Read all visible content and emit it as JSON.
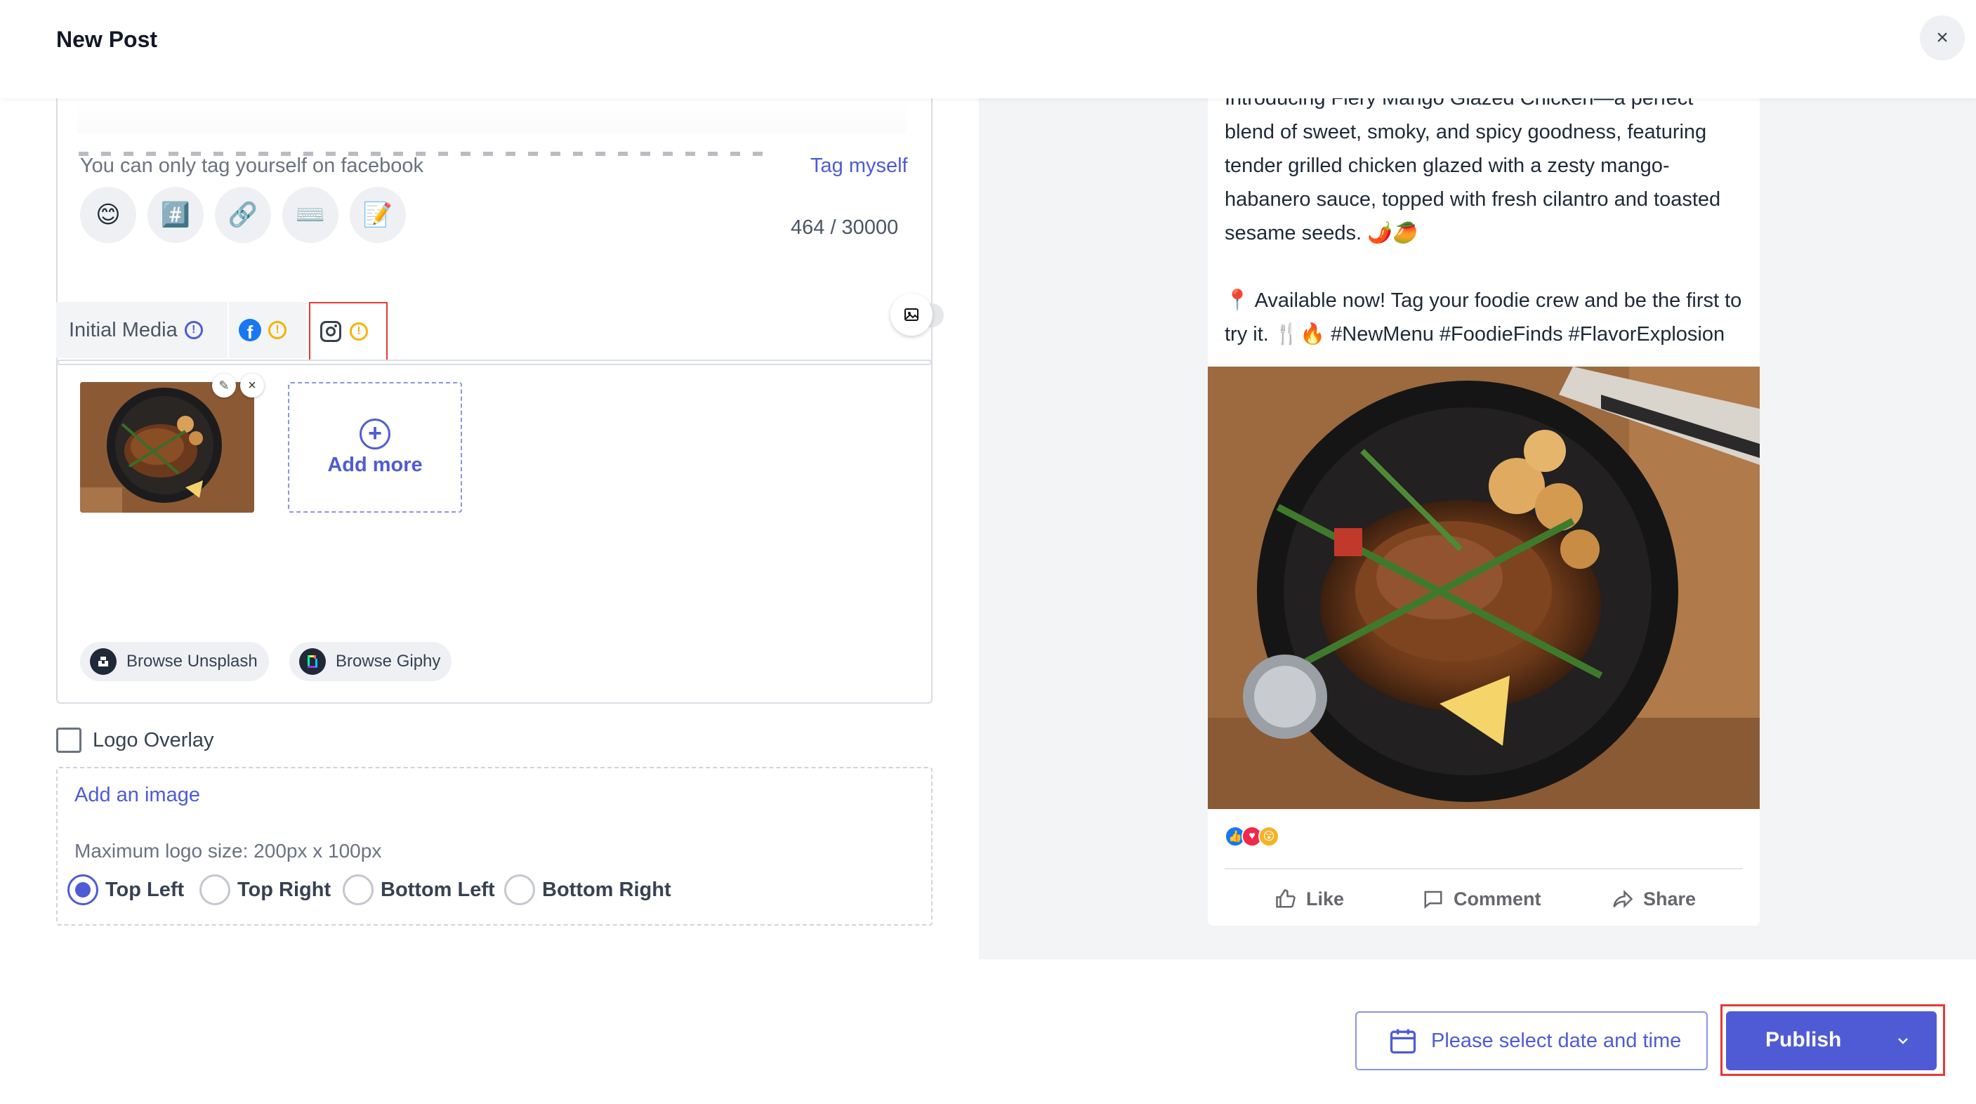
{
  "header": {
    "title": "New Post",
    "close_glyph": "×"
  },
  "composer": {
    "tag_note": "You can only tag yourself on facebook",
    "tag_myself": "Tag myself",
    "char_count": "464 / 30000",
    "tools": [
      {
        "icon": "emoji-icon",
        "glyph": "😊"
      },
      {
        "icon": "hashtag-icon",
        "glyph": "#️⃣"
      },
      {
        "icon": "link-icon",
        "glyph": "🔗"
      },
      {
        "icon": "ai-typewriter-icon",
        "glyph": "⌨️"
      },
      {
        "icon": "notes-icon",
        "glyph": "📝"
      }
    ]
  },
  "media_tabs": {
    "initial": "Initial Media",
    "facebook_glyph": "f",
    "info_glyph": "!"
  },
  "media": {
    "add_more": "Add more",
    "add_more_glyph": "+",
    "edit_glyph": "✎",
    "remove_glyph": "×",
    "browse_unsplash": "Browse Unsplash",
    "browse_giphy": "Browse Giphy"
  },
  "logo_overlay": {
    "label": "Logo Overlay",
    "add_image": "Add an image",
    "max_size": "Maximum logo size: 200px x 100px",
    "positions": [
      "Top Left",
      "Top Right",
      "Bottom Left",
      "Bottom Right"
    ],
    "selected": "Top Left"
  },
  "preview": {
    "paragraph1": "Introducing Fiery Mango Glazed Chicken—a perfect blend of sweet, smoky, and spicy goodness, featuring tender grilled chicken glazed with a zesty mango-habanero sauce, topped with fresh cilantro and toasted sesame seeds. 🌶️🥭",
    "paragraph2": "📍 Available now! Tag your foodie crew and be the first to try it. 🍴🔥 #NewMenu #FoodieFinds #FlavorExplosion",
    "like": "Like",
    "comment": "Comment",
    "share": "Share",
    "reactions": [
      {
        "icon": "like-reaction-icon",
        "glyph": "👍",
        "color": "#1877f2"
      },
      {
        "icon": "love-reaction-icon",
        "glyph": "♥",
        "color": "#f0284a"
      },
      {
        "icon": "wow-reaction-icon",
        "glyph": "😮",
        "color": "#f7b125"
      }
    ]
  },
  "footer": {
    "date_placeholder": "Please select date and time",
    "publish": "Publish"
  },
  "colors": {
    "accent": "#4f5bd5",
    "highlight_border": "#e53935",
    "preview_background": "#f3f4f6"
  }
}
